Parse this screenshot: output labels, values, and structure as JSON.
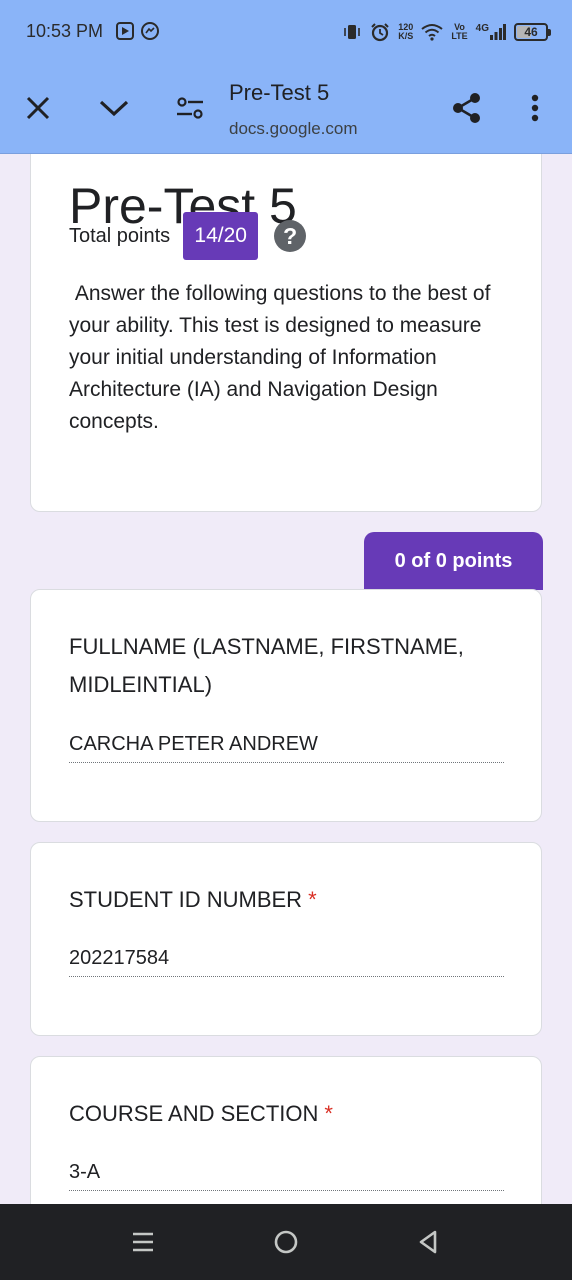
{
  "status_bar": {
    "time": "10:53 PM",
    "network_speed_value": "120",
    "network_speed_unit": "K/S",
    "volte_top": "Vo",
    "volte_bottom": "LTE",
    "network_type": "4G",
    "battery_level": "46",
    "battery_fraction": 0.46
  },
  "browser": {
    "title": "Pre-Test 5",
    "url": "docs.google.com"
  },
  "form": {
    "title": "Pre-Test 5",
    "points_label": "Total points",
    "score": "14/20",
    "help_symbol": "?",
    "description": " Answer the following questions to the best of your ability. This test is designed to measure your initial understanding of Information Architecture (IA) and Navigation Design concepts.",
    "section_points": "0 of 0 points"
  },
  "questions": [
    {
      "title": "FULLNAME (LASTNAME, FIRSTNAME, MIDLEINTIAL)",
      "required": "",
      "answer": "CARCHA PETER ANDREW"
    },
    {
      "title": "STUDENT ID NUMBER",
      "required": "*",
      "answer": "202217584"
    },
    {
      "title": "COURSE AND SECTION",
      "required": "*",
      "answer": "3-A"
    }
  ],
  "colors": {
    "toolbar": "#8ab4f8",
    "background": "#f0ebf8",
    "accent": "#673ab7",
    "required": "#d93025",
    "navbar": "#202124"
  },
  "icons": {
    "close": "close-icon",
    "collapse": "chevron-down-icon",
    "customize": "tune-icon",
    "share": "share-icon",
    "more": "more-vert-icon",
    "help": "help-icon",
    "nav_recents": "menu-lines-icon",
    "nav_home": "home-circle-icon",
    "nav_back": "back-triangle-icon"
  }
}
